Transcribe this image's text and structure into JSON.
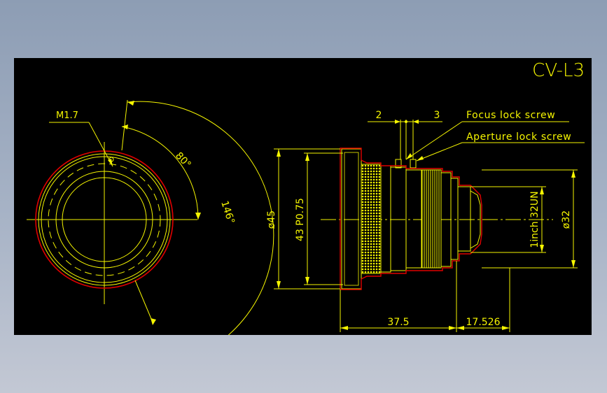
{
  "title": "CV-L3",
  "front_view": {
    "screw_label": "M1.7",
    "angle_small": "80°",
    "angle_large": "146°"
  },
  "side_view": {
    "focus_label": "Focus lock screw",
    "aperture_label": "Aperture lock screw",
    "dim_2": "2",
    "dim_3": "3",
    "dia_45": "ø45",
    "thread_43": "43 P0.75",
    "mount": "1inch 32UN",
    "dia_32": "ø32",
    "len_37_5": "37.5",
    "len_17_526": "17.526"
  },
  "colors": {
    "background": "#000000",
    "dimension": "#f5f500",
    "outline": "#e00000",
    "frame": "#8d9db4"
  }
}
